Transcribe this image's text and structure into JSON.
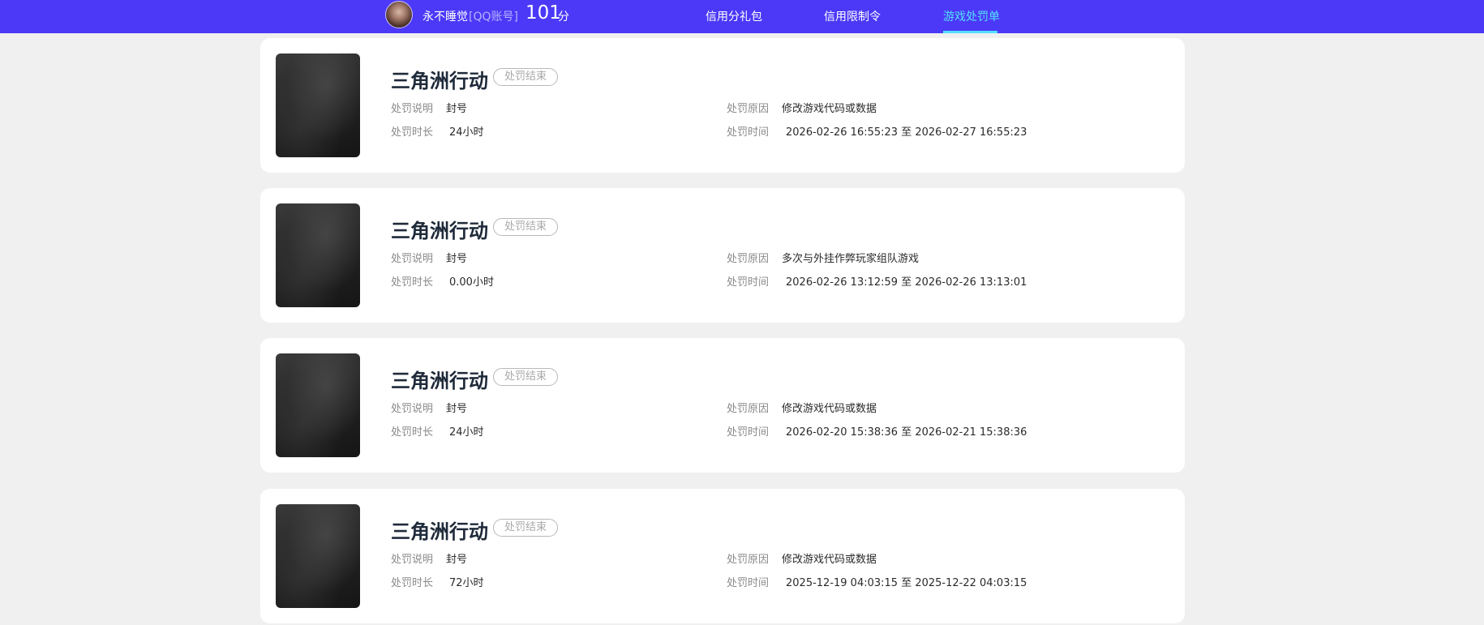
{
  "header": {
    "user_name": "永不睡觉",
    "account_type": "[QQ账号]",
    "score": "101",
    "score_unit": "分",
    "nav": [
      {
        "label": "信用分礼包",
        "active": false
      },
      {
        "label": "信用限制令",
        "active": false
      },
      {
        "label": "游戏处罚单",
        "active": true
      }
    ],
    "accent_color": "#4b39f7",
    "active_color": "#54e0ff"
  },
  "labels": {
    "description": "处罚说明",
    "duration": "处罚时长",
    "reason": "处罚原因",
    "time": "处罚时间"
  },
  "records": [
    {
      "game": "三角洲行动",
      "status": "处罚结束",
      "description": "封号",
      "duration": "24小时",
      "reason": "修改游戏代码或数据",
      "time": "2026-02-26 16:55:23 至 2026-02-27 16:55:23"
    },
    {
      "game": "三角洲行动",
      "status": "处罚结束",
      "description": "封号",
      "duration": "0.00小时",
      "reason": "多次与外挂作弊玩家组队游戏",
      "time": "2026-02-26 13:12:59 至 2026-02-26 13:13:01"
    },
    {
      "game": "三角洲行动",
      "status": "处罚结束",
      "description": "封号",
      "duration": "24小时",
      "reason": "修改游戏代码或数据",
      "time": "2026-02-20 15:38:36 至 2026-02-21 15:38:36"
    },
    {
      "game": "三角洲行动",
      "status": "处罚结束",
      "description": "封号",
      "duration": "72小时",
      "reason": "修改游戏代码或数据",
      "time": "2025-12-19 04:03:15 至 2025-12-22 04:03:15"
    }
  ]
}
